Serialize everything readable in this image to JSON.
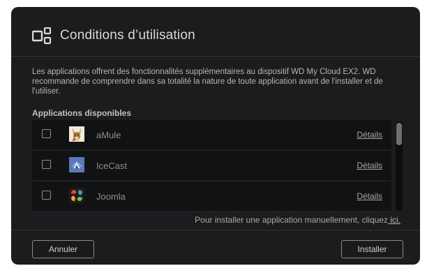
{
  "dialog": {
    "icon": "apps-grid-icon",
    "title": "Conditions d’utilisation",
    "description": "Les applications offrent des fonctionnalités supplémentaires au dispositif WD My Cloud EX2. WD recommande de comprendre dans sa totalité la nature de toute application avant de l'installer et de l'utiliser.",
    "list_heading": "Applications disponibles",
    "apps": [
      {
        "name": "aMule",
        "icon": "amule-mule-icon",
        "checked": false,
        "details_label": "Détails"
      },
      {
        "name": "IceCast",
        "icon": "icecast-icon",
        "checked": false,
        "details_label": "Détails"
      },
      {
        "name": "Joomla",
        "icon": "joomla-icon",
        "checked": false,
        "details_label": "Détails"
      }
    ],
    "manual_install_text": "Pour installer une application manuellement, cliquez",
    "manual_install_link": " ici.",
    "cancel_label": "Annuler",
    "install_label": "Installer"
  }
}
